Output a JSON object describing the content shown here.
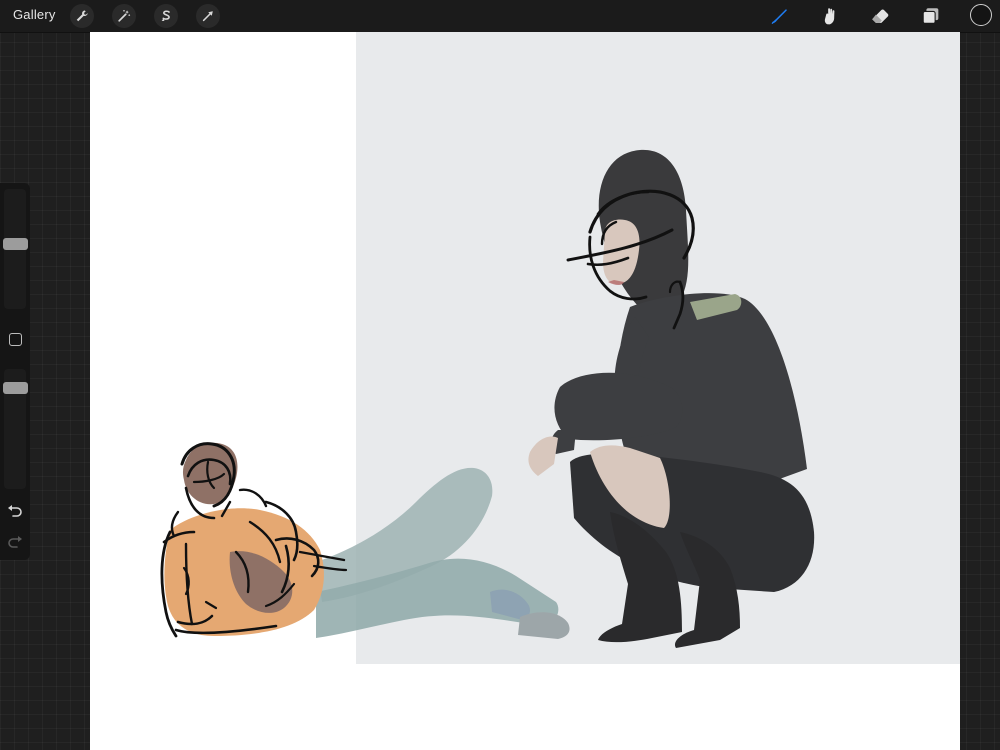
{
  "topbar": {
    "gallery_label": "Gallery",
    "left_tools": [
      {
        "name": "actions",
        "icon": "wrench-icon"
      },
      {
        "name": "adjustments",
        "icon": "magic-wand-icon"
      },
      {
        "name": "selection",
        "icon": "selection-s-icon"
      },
      {
        "name": "transform",
        "icon": "arrow-cursor-icon"
      }
    ],
    "right_tools": [
      {
        "name": "brush",
        "icon": "brush-icon",
        "active": true
      },
      {
        "name": "smudge",
        "icon": "smudge-icon",
        "active": false
      },
      {
        "name": "eraser",
        "icon": "eraser-icon",
        "active": false
      },
      {
        "name": "layers",
        "icon": "layers-icon",
        "active": false
      }
    ],
    "current_color": "#141414"
  },
  "sidebar": {
    "brush_size": 0.55,
    "opacity": 0.88
  },
  "colors": {
    "accent": "#1f7cf0",
    "canvas_bg": "#ffffff",
    "photo_bg": "#e8eaec",
    "stroke": "#111111"
  }
}
